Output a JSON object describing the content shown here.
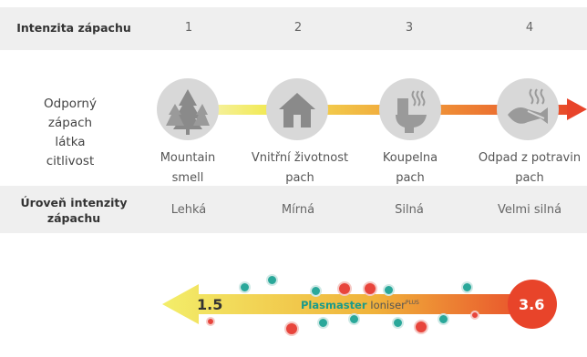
{
  "table": {
    "intensity_header": "Intenzita zápachu",
    "levels": [
      "1",
      "2",
      "3",
      "4"
    ],
    "sensitivity_label": "Odporný\nzápach\nlátka\ncitlivost",
    "level_header": "Úroveň intenzity\nzápachu",
    "level_names": [
      "Lehká",
      "Mírná",
      "Silná",
      "Velmi silná"
    ]
  },
  "nodes": [
    {
      "icon": "forest-icon",
      "caption": "Mountain\nsmell"
    },
    {
      "icon": "house-icon",
      "caption": "Vnitřní životnost\npach"
    },
    {
      "icon": "toilet-odor-icon",
      "caption": "Koupelna\npach"
    },
    {
      "icon": "fish-waste-odor-icon",
      "caption": "Odpad z potravin\npach"
    }
  ],
  "ioniser": {
    "left_value": "1.5",
    "brand": "Plasmaster",
    "product": "Ioniser",
    "suffix": "PLUS",
    "right_value": "3.6"
  },
  "colors": {
    "band": "#efefef",
    "gradient_start": "#f3ef7a",
    "gradient_end": "#e8442a",
    "node": "#d8d8d8",
    "ion_minus": "#2aa89a",
    "ion_plus": "#e8453c"
  }
}
